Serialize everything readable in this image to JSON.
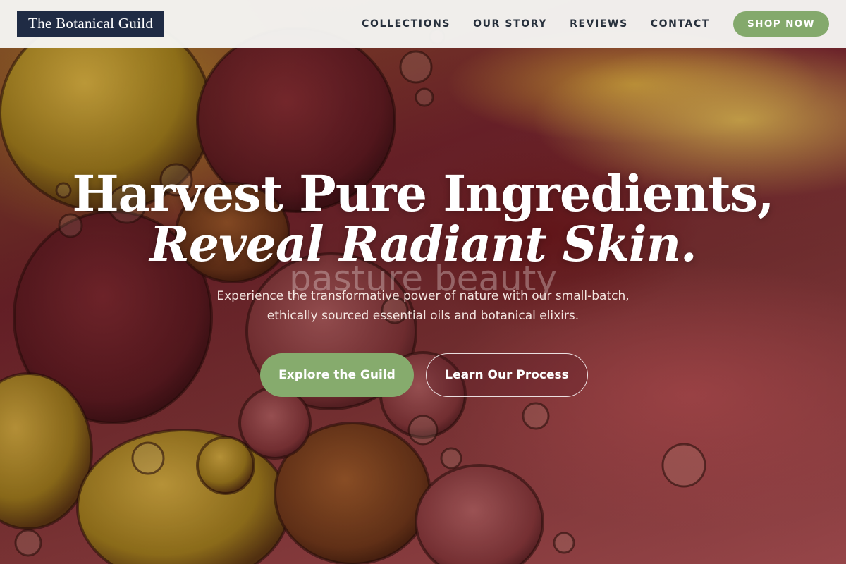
{
  "header": {
    "brand": "The Botanical Guild",
    "nav": [
      "COLLECTIONS",
      "OUR STORY",
      "REVIEWS",
      "CONTACT"
    ],
    "cta": "SHOP NOW"
  },
  "hero": {
    "headline_line1": "Harvest Pure Ingredients,",
    "headline_line2": "Reveal Radiant Skin.",
    "watermark": "pasture beauty",
    "subtitle": "Experience the transformative power of nature with our small-batch, ethically sourced essential oils and botanical elixirs.",
    "primary_button": "Explore the Guild",
    "secondary_button": "Learn Our Process"
  },
  "colors": {
    "brand_bg": "#1f2b44",
    "accent_green": "#84a96c",
    "header_bg": "#f6f6f4",
    "nav_text": "#27303c"
  }
}
